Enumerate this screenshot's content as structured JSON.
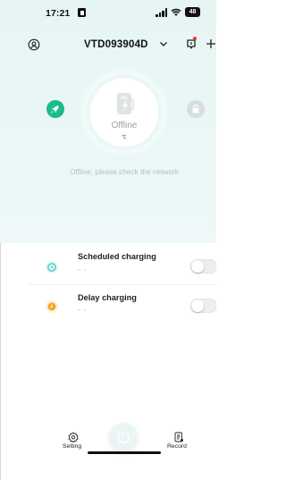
{
  "status_bar": {
    "time": "17:21",
    "battery": "48"
  },
  "header": {
    "device_id": "VTD093904D"
  },
  "charger": {
    "badge": "AC",
    "status": "Offline",
    "message": "Offline, please check the network"
  },
  "settings": [
    {
      "label": "Scheduled charging",
      "value": "- -",
      "enabled": false,
      "icon": "clock-icon",
      "color": "#2ec4b6"
    },
    {
      "label": "Delay charging",
      "value": "- -",
      "enabled": false,
      "icon": "timer-icon",
      "color": "#f6a623"
    }
  ],
  "tabs": {
    "setting": "Setting",
    "record": "Record"
  },
  "colors": {
    "accent": "#1abc8c",
    "hero_bg": "#e8f6f5",
    "alert": "#e53935"
  }
}
